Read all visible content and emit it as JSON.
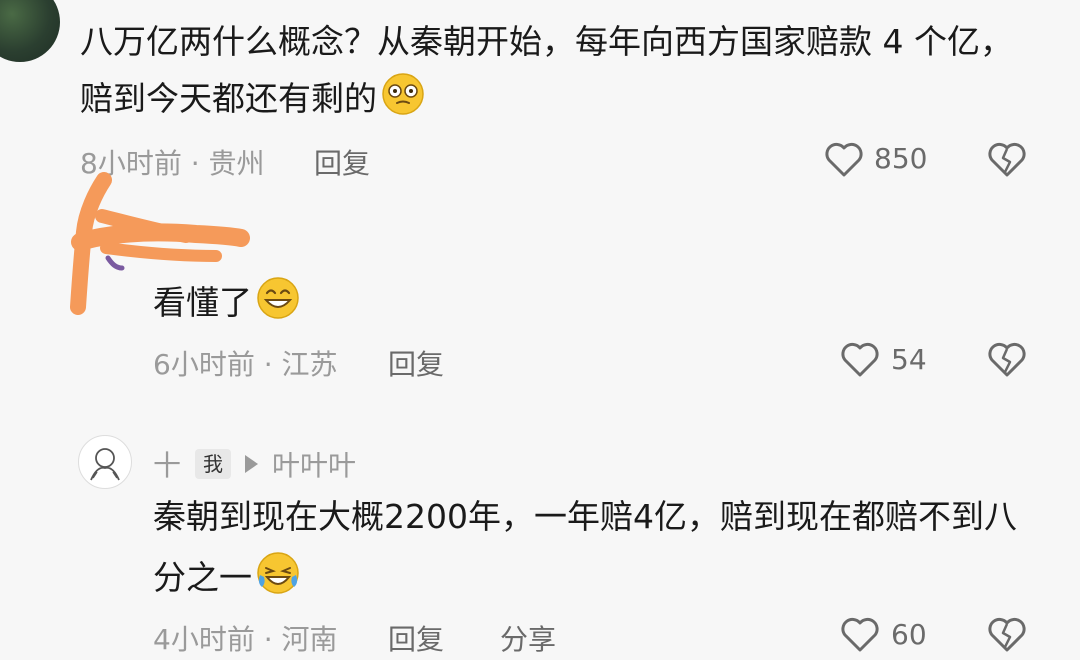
{
  "comment1": {
    "text": "八万亿两什么概念？从秦朝开始，每年向西方国家赔款 4 个亿，赔到今天都还有剩的",
    "line1": "八万亿两什么概念？从秦朝开始，每年向西方国家赔款 4 个亿，",
    "line2": "赔到今天都还有剩的",
    "meta": "8小时前 · 贵州",
    "reply": "回复",
    "likes": "850"
  },
  "comment2": {
    "text": "看懂了",
    "meta": "6小时前 · 江苏",
    "reply": "回复",
    "likes": "54"
  },
  "comment3": {
    "user": "十",
    "badge": "我",
    "reply_to": "叶叶叶",
    "line1": "秦朝到现在大概2200年，一年赔4亿，赔到现在都赔不到八",
    "line2": "分之一",
    "meta": "4小时前 · 河南",
    "reply": "回复",
    "share": "分享",
    "likes": "60"
  },
  "icons": [
    "heart-icon",
    "broken-heart-icon",
    "dizzy-face-emoji",
    "grin-emoji",
    "laughing-tears-emoji"
  ]
}
